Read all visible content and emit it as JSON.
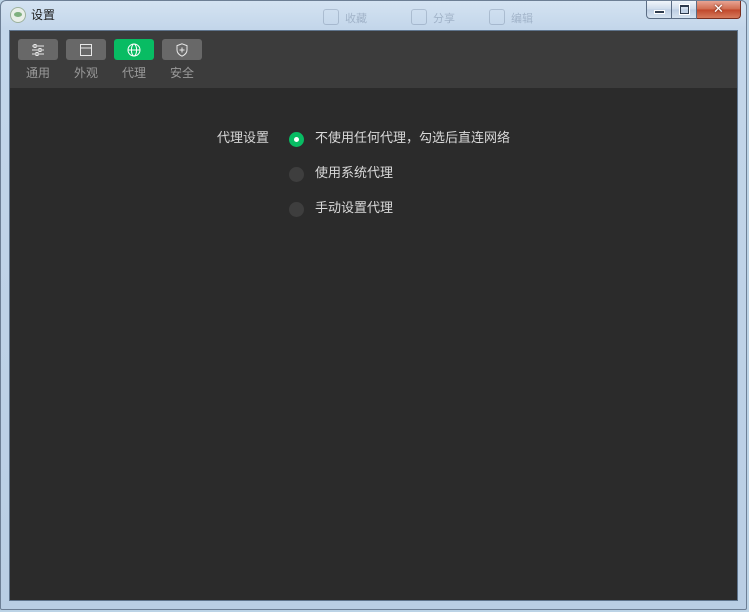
{
  "window": {
    "title": "设置",
    "close_glyph": "✕"
  },
  "background_ghost": {
    "items": [
      "收藏",
      "分享",
      "编辑"
    ]
  },
  "toolbar": {
    "tabs": [
      {
        "label": "通用",
        "icon": "sliders-icon",
        "active": false
      },
      {
        "label": "外观",
        "icon": "window-icon",
        "active": false
      },
      {
        "label": "代理",
        "icon": "globe-icon",
        "active": true
      },
      {
        "label": "安全",
        "icon": "shield-icon",
        "active": false
      }
    ]
  },
  "proxy": {
    "section_label": "代理设置",
    "options": [
      {
        "label": "不使用任何代理，勾选后直连网络",
        "checked": true
      },
      {
        "label": "使用系统代理",
        "checked": false
      },
      {
        "label": "手动设置代理",
        "checked": false
      }
    ]
  },
  "colors": {
    "accent": "#08bc63",
    "panel": "#2b2b2b",
    "toolbar": "#3c3c3c",
    "tab_inactive": "#686868"
  }
}
